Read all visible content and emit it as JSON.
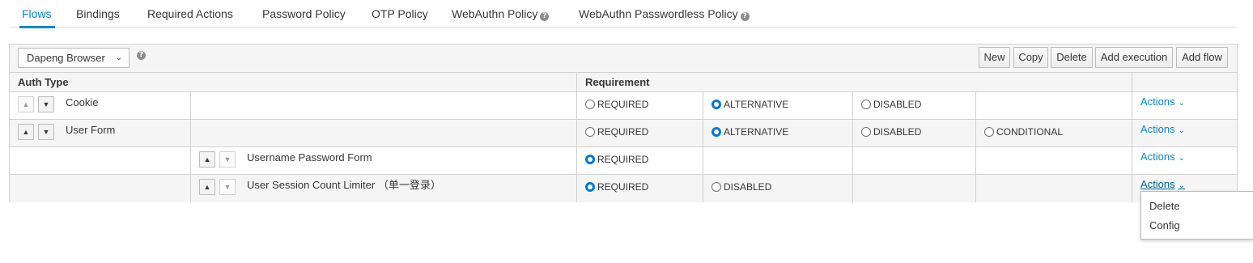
{
  "tabs": [
    {
      "label": "Flows"
    },
    {
      "label": "Bindings"
    },
    {
      "label": "Required Actions"
    },
    {
      "label": "Password Policy"
    },
    {
      "label": "OTP Policy"
    },
    {
      "label": "WebAuthn Policy"
    },
    {
      "label": "WebAuthn Passwordless Policy"
    }
  ],
  "toolbar": {
    "flow_select": "Dapeng Browser",
    "buttons": {
      "new": "New",
      "copy": "Copy",
      "delete": "Delete",
      "add_execution": "Add execution",
      "add_flow": "Add flow"
    }
  },
  "headers": {
    "auth_type": "Auth Type",
    "requirement": "Requirement"
  },
  "requirement_labels": {
    "required": "REQUIRED",
    "alternative": "ALTERNATIVE",
    "disabled": "DISABLED",
    "conditional": "CONDITIONAL"
  },
  "rows": [
    {
      "name": "Cookie",
      "selected": "ALTERNATIVE",
      "actions": "Actions"
    },
    {
      "name": "User Form",
      "selected": "ALTERNATIVE",
      "actions": "Actions"
    },
    {
      "name": "Username Password Form",
      "selected": "REQUIRED",
      "actions": "Actions"
    },
    {
      "name": "User Session Count Limiter （单一登录）",
      "selected": "REQUIRED",
      "actions": "Actions"
    }
  ],
  "actions_menu": {
    "delete": "Delete",
    "config": "Config"
  },
  "colors": {
    "accent": "#0088ce",
    "radio_selected": "#0078d7"
  }
}
